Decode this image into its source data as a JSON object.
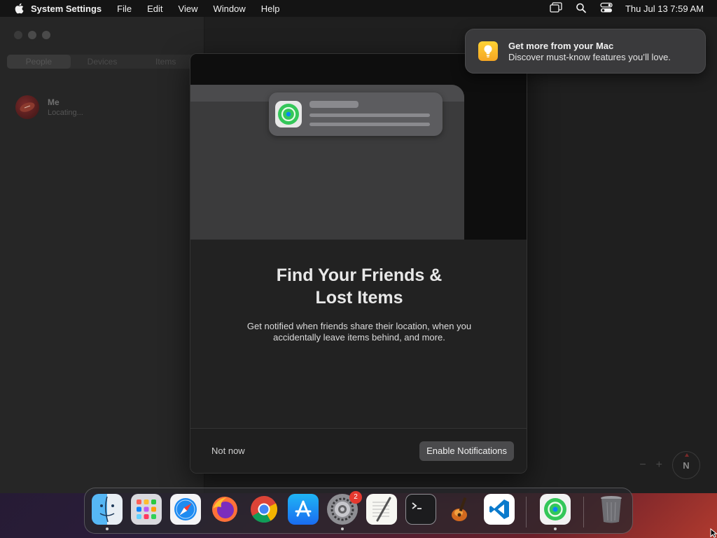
{
  "menubar": {
    "app_name": "System Settings",
    "menus": [
      "File",
      "Edit",
      "View",
      "Window",
      "Help"
    ],
    "clock": "Thu Jul 13  7:59 AM"
  },
  "findmy": {
    "tabs": [
      "People",
      "Devices",
      "Items"
    ],
    "person": {
      "name": "Me",
      "status": "Locating..."
    },
    "compass_label": "N",
    "zoom_out": "−",
    "zoom_in": "+"
  },
  "sheet": {
    "title": "Find Your Friends &\nLost Items",
    "body": "Get notified when friends share their location, when you accidentally leave items behind, and more.",
    "secondary_button": "Not now",
    "primary_button": "Enable Notifications"
  },
  "banner": {
    "title": "Get more from your Mac",
    "text": "Discover must-know features you’ll love."
  },
  "dock": {
    "items": [
      {
        "name": "Finder",
        "icon": "finder-icon",
        "running": true
      },
      {
        "name": "Launchpad",
        "icon": "launchpad-icon",
        "running": false
      },
      {
        "name": "Safari",
        "icon": "safari-icon",
        "running": false
      },
      {
        "name": "Firefox",
        "icon": "firefox-icon",
        "running": false
      },
      {
        "name": "Chrome",
        "icon": "chrome-icon",
        "running": false
      },
      {
        "name": "App Store",
        "icon": "app-store-icon",
        "running": false
      },
      {
        "name": "System Settings",
        "icon": "system-settings-icon",
        "running": true,
        "badge": "2"
      },
      {
        "name": "TextEdit",
        "icon": "textedit-icon",
        "running": false
      },
      {
        "name": "Terminal",
        "icon": "terminal-icon",
        "running": false
      },
      {
        "name": "GarageBand",
        "icon": "garageband-icon",
        "running": false
      },
      {
        "name": "VS Code",
        "icon": "vscode-icon",
        "running": false
      },
      {
        "name": "Find My",
        "icon": "find-my-icon",
        "running": true
      },
      {
        "name": "Trash",
        "icon": "trash-icon",
        "running": false
      }
    ]
  },
  "colors": {
    "accent_green": "#34c759",
    "badge_red": "#e5392f",
    "banner_icon_yellow": "#ffd234"
  }
}
